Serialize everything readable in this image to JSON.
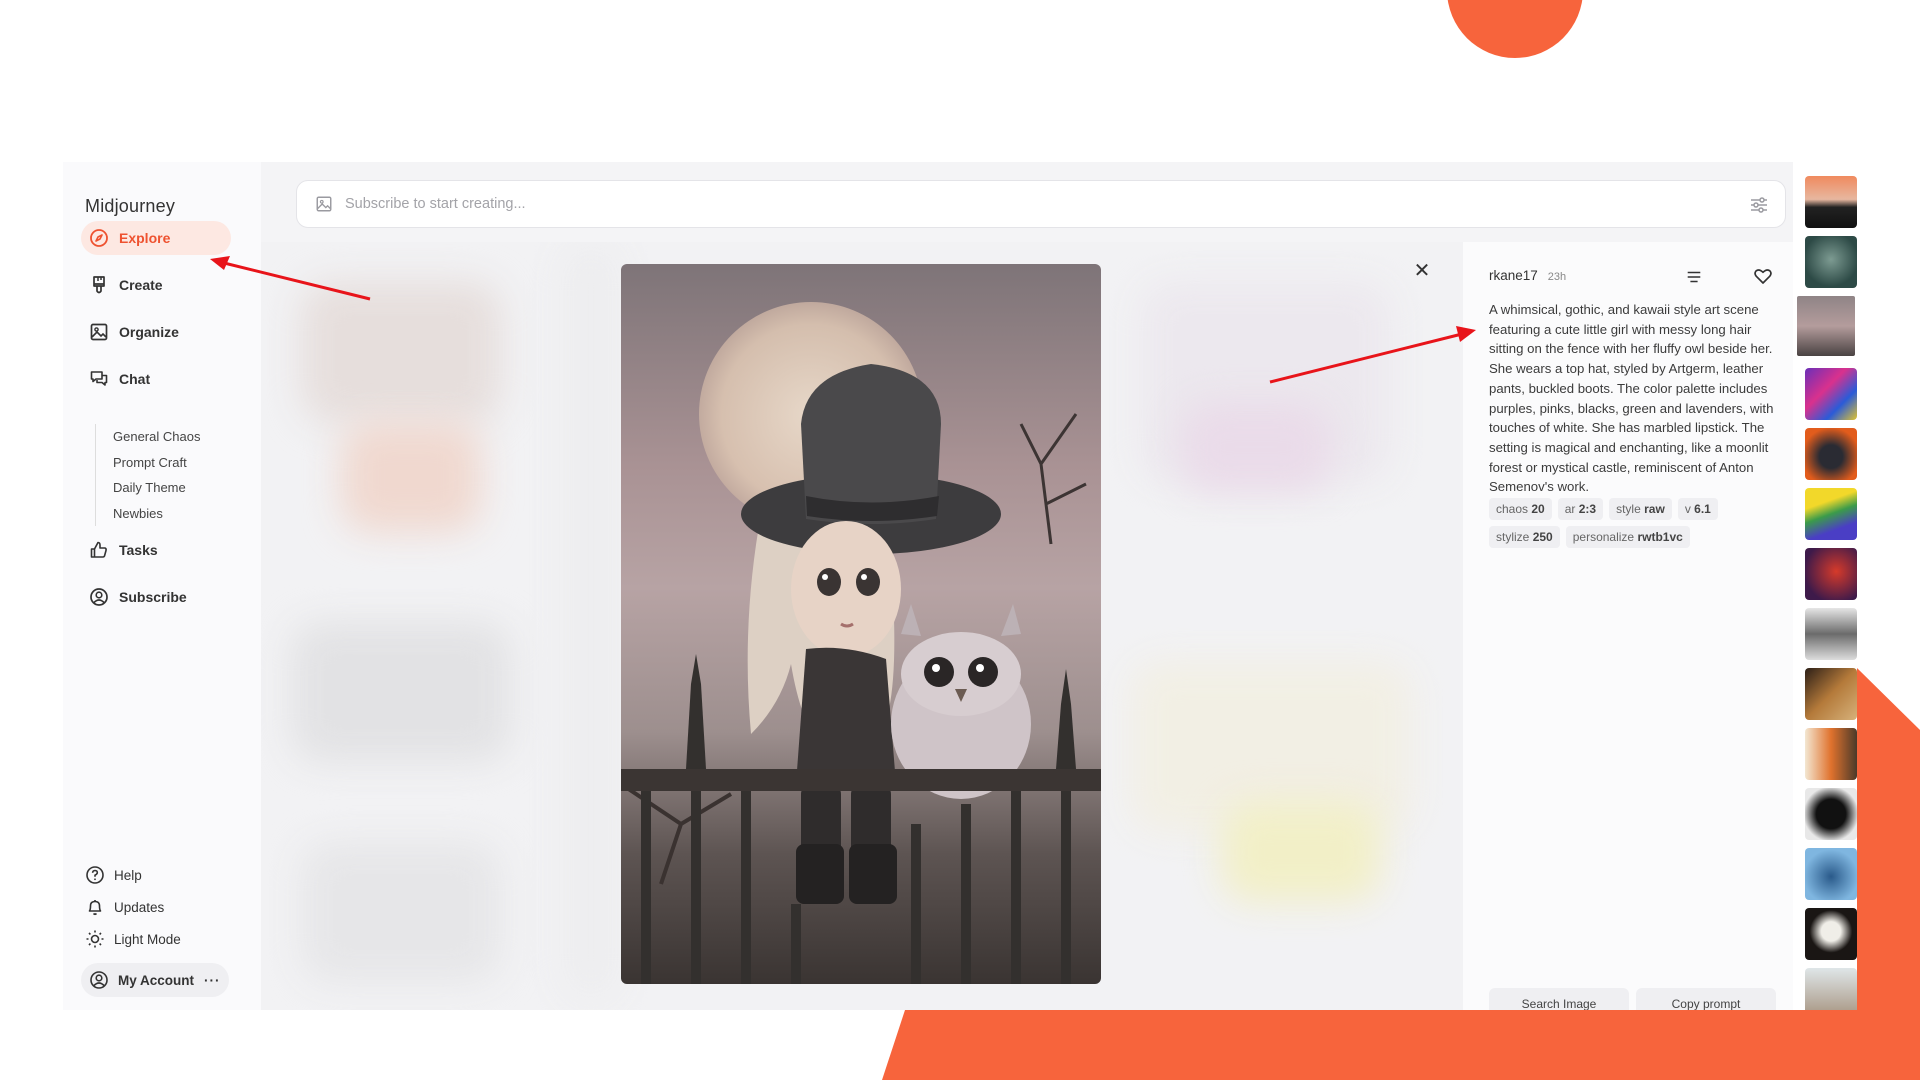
{
  "sidebar": {
    "brand": "Midjourney",
    "nav": [
      {
        "label": "Explore",
        "icon": "compass-icon",
        "active": true
      },
      {
        "label": "Create",
        "icon": "brush-icon"
      },
      {
        "label": "Organize",
        "icon": "image-icon"
      },
      {
        "label": "Chat",
        "icon": "chat-icon"
      }
    ],
    "chat_rooms": [
      "General Chaos",
      "Prompt Craft",
      "Daily Theme",
      "Newbies"
    ],
    "nav2": [
      {
        "label": "Tasks",
        "icon": "thumbs-up-icon"
      },
      {
        "label": "Subscribe",
        "icon": "user-circle-icon"
      }
    ],
    "bottom": [
      {
        "label": "Help",
        "icon": "help-icon"
      },
      {
        "label": "Updates",
        "icon": "bell-icon"
      },
      {
        "label": "Light Mode",
        "icon": "sun-icon"
      }
    ],
    "account": {
      "label": "My Account",
      "more": "···"
    }
  },
  "search": {
    "placeholder": "Subscribe to start creating..."
  },
  "viewer": {
    "close": "✕"
  },
  "details": {
    "author": "rkane17",
    "time": "23h",
    "prompt": "A whimsical, gothic, and kawaii style art scene featuring a cute little girl with messy long hair sitting on the fence with her fluffy owl beside her. She wears a top hat, styled by Artgerm, leather pants, buckled boots. The color palette includes purples, pinks, blacks, green and lavenders, with touches of white. She has marbled lipstick. The setting is magical and enchanting, like a moonlit forest or mystical castle, reminiscent of Anton Semenov's work.",
    "tags": [
      {
        "key": "chaos",
        "value": "20"
      },
      {
        "key": "ar",
        "value": "2:3"
      },
      {
        "key": "style",
        "value": "raw"
      },
      {
        "key": "v",
        "value": "6.1"
      },
      {
        "key": "stylize",
        "value": "250"
      },
      {
        "key": "personalize",
        "value": "rwtb1vc"
      }
    ],
    "search_image": "Search Image",
    "copy_prompt": "Copy prompt"
  },
  "colors": {
    "accent": "#ee5230",
    "accent_bg": "#fde8e2",
    "brand_orange": "#f7643c",
    "annotation_arrow": "#e8141a"
  }
}
